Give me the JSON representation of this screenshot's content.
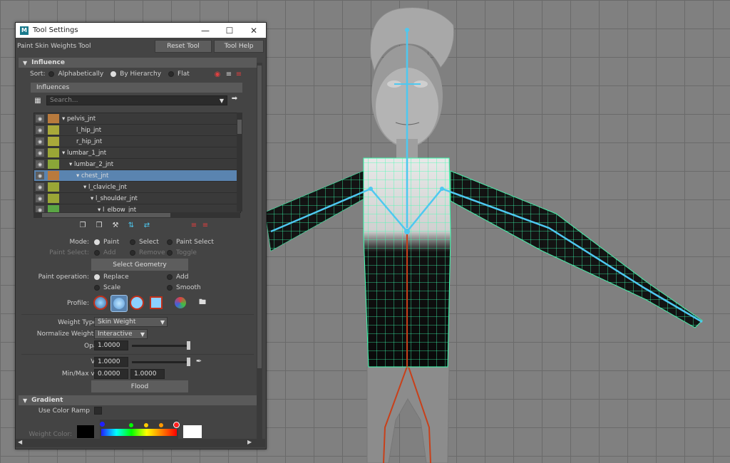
{
  "window": {
    "title": "Tool Settings",
    "app_icon": "M"
  },
  "header": {
    "tool_name": "Paint Skin Weights Tool",
    "reset_label": "Reset Tool",
    "help_label": "Tool Help"
  },
  "influence": {
    "section_label": "Influence",
    "sort_label": "Sort:",
    "sort_options": [
      "Alphabetically",
      "By Hierarchy",
      "Flat"
    ],
    "sort_selected": "By Hierarchy",
    "influences_label": "Influences",
    "search_placeholder": "Search...",
    "items": [
      {
        "name": "pelvis_jnt",
        "color": "#b87a3d",
        "indent": 0,
        "expander": true
      },
      {
        "name": "l_hip_jnt",
        "color": "#a9a93a",
        "indent": 2,
        "expander": false
      },
      {
        "name": "r_hip_jnt",
        "color": "#a9a93a",
        "indent": 2,
        "expander": false
      },
      {
        "name": "lumbar_1_jnt",
        "color": "#9aa636",
        "indent": 0,
        "expander": true
      },
      {
        "name": "lumbar_2_jnt",
        "color": "#8aa638",
        "indent": 1,
        "expander": true
      },
      {
        "name": "chest_jnt",
        "color": "#b87a3d",
        "indent": 2,
        "expander": true,
        "selected": true
      },
      {
        "name": "l_clavicle_jnt",
        "color": "#9aa636",
        "indent": 3,
        "expander": true
      },
      {
        "name": "l_shoulder_jnt",
        "color": "#9aa636",
        "indent": 4,
        "expander": true
      },
      {
        "name": "l_elbow_jnt",
        "color": "#5aa644",
        "indent": 5,
        "expander": true
      },
      {
        "name": "",
        "color": "#3aa68a",
        "indent": 6,
        "expander": false
      }
    ]
  },
  "mode": {
    "label": "Mode:",
    "options": [
      "Paint",
      "Select",
      "Paint Select"
    ],
    "selected": "Paint",
    "paint_select_label": "Paint Select:",
    "paint_select_options": [
      "Add",
      "Remove",
      "Toggle"
    ],
    "select_geometry_label": "Select Geometry"
  },
  "paint_operation": {
    "label": "Paint operation:",
    "options": [
      "Replace",
      "Add",
      "Scale",
      "Smooth"
    ],
    "selected": "Replace"
  },
  "profile": {
    "label": "Profile:",
    "selected_index": 1
  },
  "weights": {
    "weight_type_label": "Weight Type:",
    "weight_type_value": "Skin Weight",
    "normalize_label": "Normalize Weights:",
    "normalize_value": "Interactive",
    "opacity_label": "Opacity:",
    "opacity_value": "1.0000",
    "value_label": "Value:",
    "value_value": "1.0000",
    "minmax_label": "Min/Max value:",
    "min_value": "0.0000",
    "max_value": "1.0000",
    "flood_label": "Flood"
  },
  "gradient": {
    "section_label": "Gradient",
    "use_color_ramp_label": "Use Color Ramp",
    "weight_color_label": "Weight Color:"
  },
  "colors": {
    "wire": "#3dffb0",
    "joint": "#4ec8f0",
    "selection": "#5a84b0"
  }
}
